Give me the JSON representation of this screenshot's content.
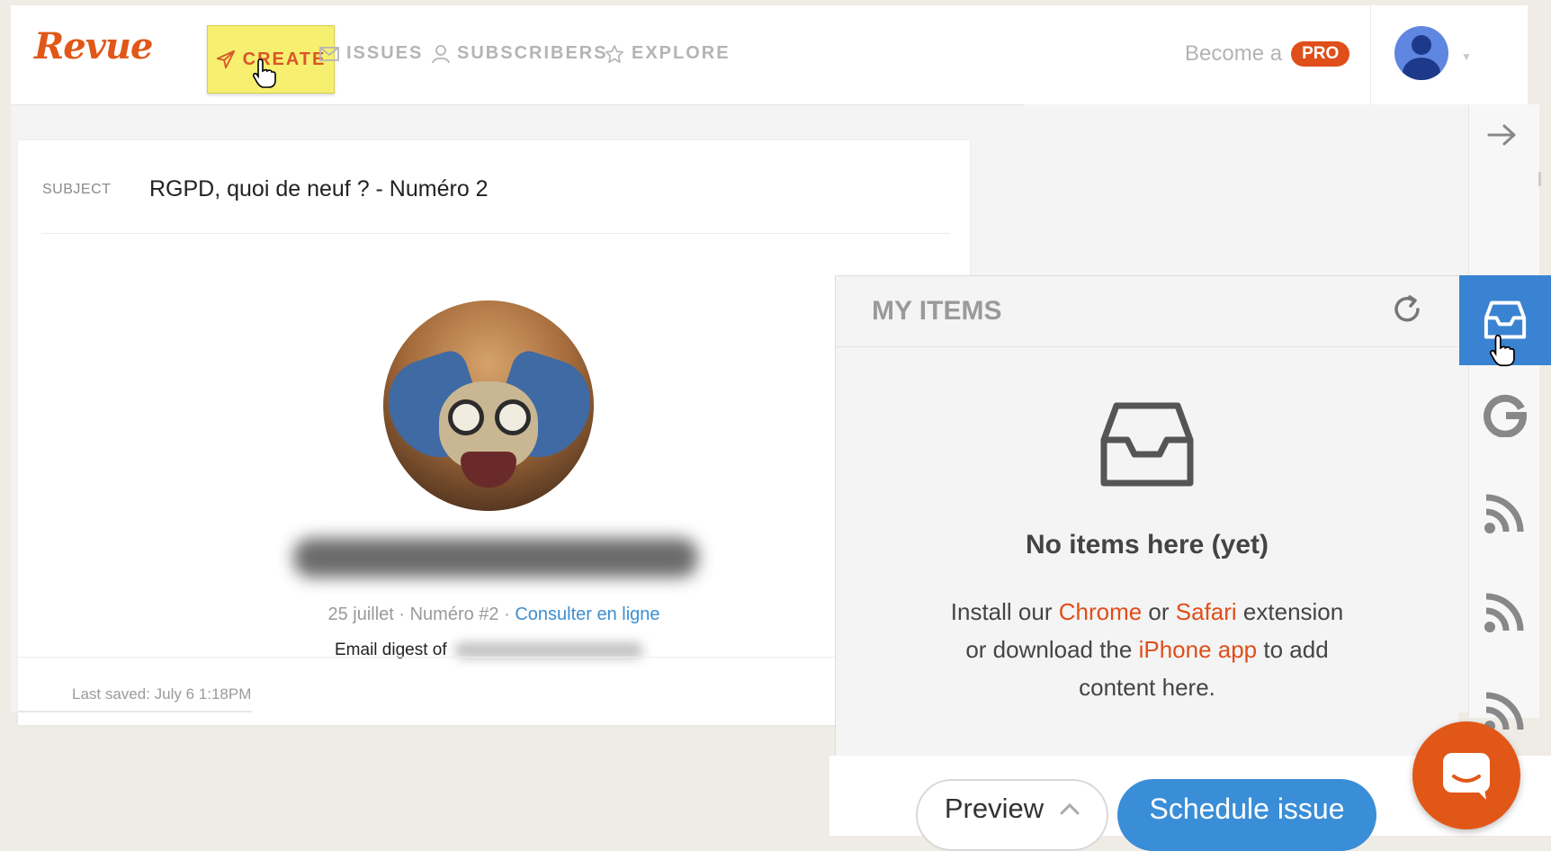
{
  "brand": {
    "logo": "Revue",
    "accent": "#e15718"
  },
  "nav": {
    "create": "CREATE",
    "issues": "ISSUES",
    "subscribers": "SUBSCRIBERS",
    "explore": "EXPLORE",
    "become": "Become a",
    "pro": "PRO"
  },
  "editor": {
    "subject_label": "SUBJECT",
    "subject_value": "RGPD, quoi de neuf ? - Numéro 2",
    "meta_date": "25 juillet · Numéro #2 · ",
    "meta_link": "Consulter en ligne",
    "digest_prefix": "Email digest of",
    "last_saved": "Last saved: July 6 1:18PM"
  },
  "items_panel": {
    "title": "MY ITEMS",
    "empty_title": "No items here (yet)",
    "text_1": "Install our ",
    "chrome": "Chrome",
    "text_2": " or ",
    "safari": "Safari",
    "text_3": " extension or download the ",
    "iphone_app": "iPhone app",
    "text_4": " to add content here."
  },
  "sources": [
    {
      "icon": "inbox-tray-icon",
      "active": true
    },
    {
      "icon": "google-icon",
      "active": false
    },
    {
      "icon": "rss-icon",
      "active": false
    },
    {
      "icon": "rss-icon",
      "active": false
    },
    {
      "icon": "rss-icon",
      "active": false
    }
  ],
  "footer": {
    "preview": "Preview",
    "schedule": "Schedule issue"
  },
  "colors": {
    "create_bg": "#f7ef6f",
    "link_blue": "#3d8fd0",
    "active_tab": "#3a83d2",
    "schedule_btn": "#3a8ed8",
    "pro_badge": "#e04e19"
  }
}
